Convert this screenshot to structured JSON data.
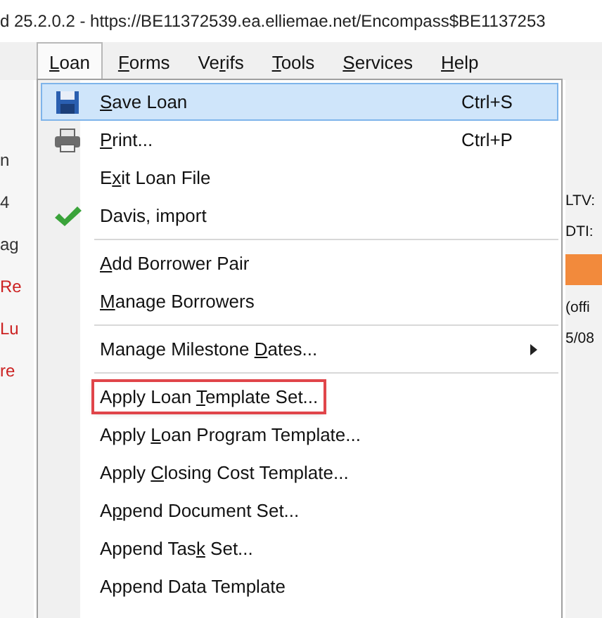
{
  "window": {
    "title": "d 25.2.0.2 - https://BE11372539.ea.elliemae.net/Encompass$BE1137253"
  },
  "menu_bar": [
    {
      "key": "L",
      "after": "oan",
      "selected": true
    },
    {
      "key": "F",
      "after": "orms",
      "selected": false
    },
    {
      "before": "Ve",
      "key": "r",
      "after": "ifs",
      "selected": false
    },
    {
      "key": "T",
      "after": "ools",
      "selected": false
    },
    {
      "key": "S",
      "after": "ervices",
      "selected": false
    },
    {
      "key": "H",
      "after": "elp",
      "selected": false
    }
  ],
  "background": {
    "left": [
      {
        "text": "n",
        "color": "#333333"
      },
      {
        "text": "4",
        "color": "#333333"
      },
      {
        "text": "ag",
        "color": "#333333"
      },
      {
        "text": "Re",
        "color": "#cc2222"
      },
      {
        "text": "Lu",
        "color": "#cc2222"
      },
      {
        "text": "re",
        "color": "#cc2222"
      }
    ],
    "right": [
      "LTV:",
      "DTI:",
      "(offi",
      "5/08"
    ]
  },
  "menu": [
    {
      "kind": "save",
      "key": "S",
      "after": "ave Loan",
      "shortcut": "Ctrl+S",
      "highlighted": true,
      "annotated": false,
      "submenu": false
    },
    {
      "kind": "print",
      "key": "P",
      "after": "rint...",
      "shortcut": "Ctrl+P",
      "highlighted": false,
      "annotated": false,
      "submenu": false
    },
    {
      "kind": "item",
      "before": "E",
      "key": "x",
      "after": "it Loan File",
      "highlighted": false,
      "annotated": false,
      "submenu": false
    },
    {
      "kind": "checked",
      "before": "Davis, import",
      "highlighted": false,
      "annotated": false,
      "submenu": false
    },
    {
      "kind": "separator"
    },
    {
      "kind": "item",
      "key": "A",
      "after": "dd Borrower Pair",
      "highlighted": false,
      "annotated": false,
      "submenu": false
    },
    {
      "kind": "item",
      "key": "M",
      "after": "anage Borrowers",
      "highlighted": false,
      "annotated": false,
      "submenu": false
    },
    {
      "kind": "separator"
    },
    {
      "kind": "item",
      "before": "Manage Milestone ",
      "key": "D",
      "after": "ates...",
      "highlighted": false,
      "annotated": false,
      "submenu": true
    },
    {
      "kind": "separator"
    },
    {
      "kind": "item",
      "before": "Apply Loan ",
      "key": "T",
      "after": "emplate Set...",
      "highlighted": false,
      "annotated": true,
      "submenu": false
    },
    {
      "kind": "item",
      "before": "Apply ",
      "key": "L",
      "after": "oan Program Template...",
      "highlighted": false,
      "annotated": false,
      "submenu": false
    },
    {
      "kind": "item",
      "before": "Apply ",
      "key": "C",
      "after": "losing Cost Template...",
      "highlighted": false,
      "annotated": false,
      "submenu": false
    },
    {
      "kind": "item",
      "before": "A",
      "key": "p",
      "after": "pend Document Set...",
      "highlighted": false,
      "annotated": false,
      "submenu": false
    },
    {
      "kind": "item",
      "before": "Append Tas",
      "key": "k",
      "after": " Set...",
      "highlighted": false,
      "annotated": false,
      "submenu": false
    },
    {
      "kind": "item",
      "before": "Append Data Template",
      "highlighted": false,
      "annotated": false,
      "submenu": false
    }
  ]
}
